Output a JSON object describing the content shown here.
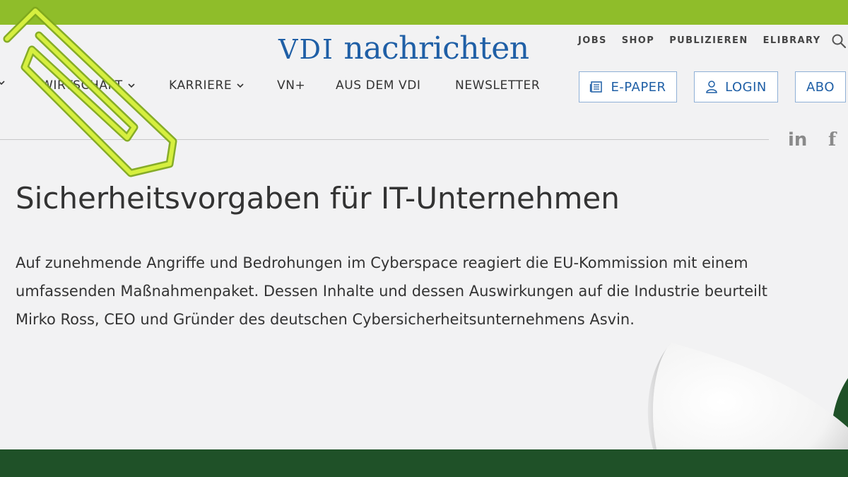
{
  "header": {
    "logo_prefix": "VDI",
    "logo_main": "nachrichten",
    "utility_links": [
      "JOBS",
      "SHOP",
      "PUBLIZIEREN",
      "ELIBRARY"
    ],
    "main_nav": [
      "WIRTSCHAFT",
      "KARRIERE",
      "VN+",
      "AUS DEM VDI",
      "NEWSLETTER"
    ],
    "buttons": {
      "epaper": "E-PAPER",
      "login": "LOGIN",
      "abo": "ABO"
    },
    "social": {
      "linkedin": "in",
      "facebook": "f"
    }
  },
  "article": {
    "title": "Sicherheitsvorgaben für IT-Unternehmen",
    "lead": "Auf zunehmende Angriffe und Bedrohungen im Cyberspace reagiert die EU-Kommission mit einem umfassenden Maßnahmenpaket. Dessen Inhalte und dessen Auswirkungen auf die Industrie beurteilt Mirko Ross, CEO und Gründer des deutschen Cybersicherheitsunternehmens Asvin."
  },
  "colors": {
    "top_stripe": "#8fbd2a",
    "bottom_band": "#1f5128",
    "brand_blue": "#1f5fa6",
    "page_bg": "#f2f2f3"
  },
  "icons": [
    "search-icon",
    "chevron-down-icon",
    "newspaper-icon",
    "user-icon",
    "paperclip-icon",
    "page-curl"
  ]
}
